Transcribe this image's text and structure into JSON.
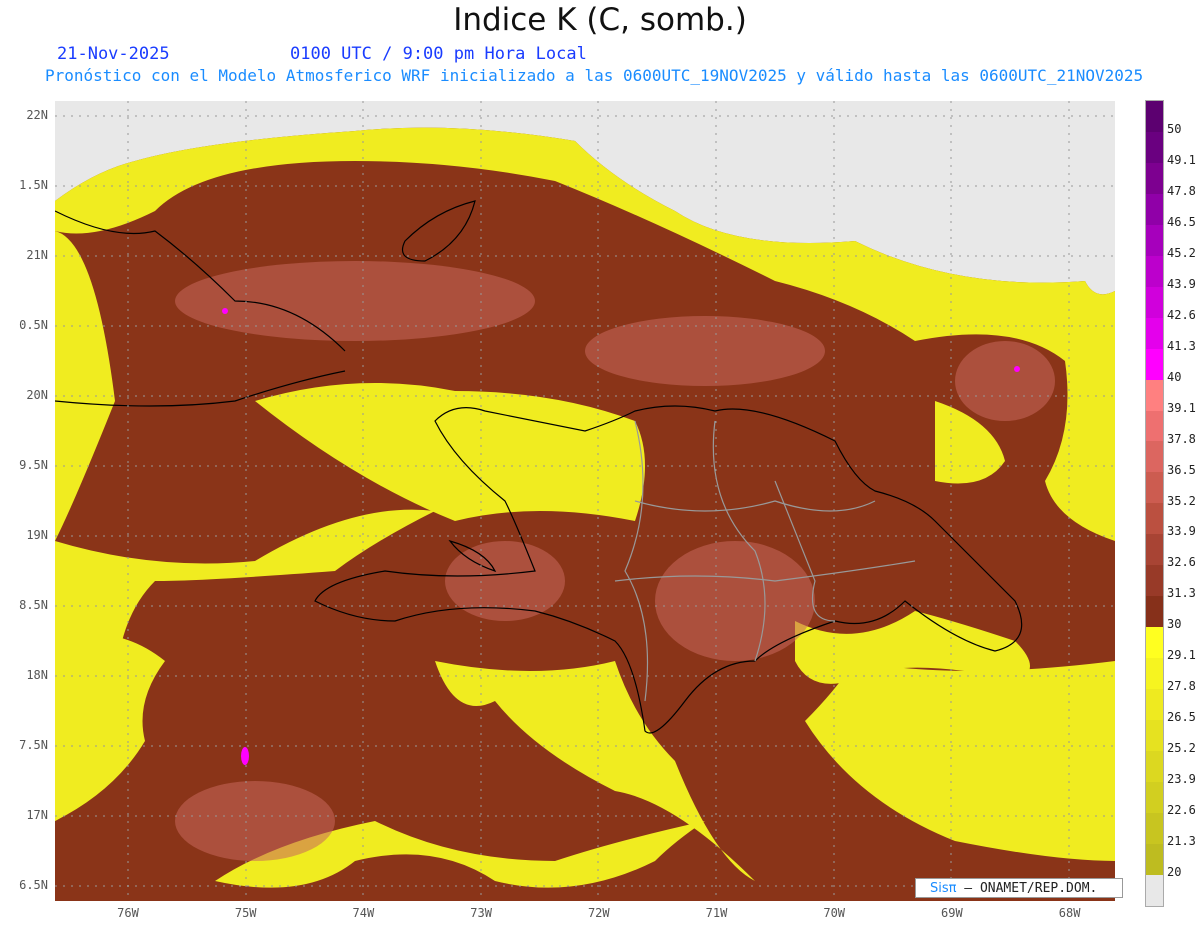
{
  "header": {
    "title": "Indice K (C, somb.)",
    "date": "21-Nov-2025",
    "time": "0100 UTC / 9:00 pm Hora Local",
    "subtitle": "Pronóstico con el Modelo Atmosferico WRF inicializado a las 0600UTC_19NOV2025 y válido hasta las  0600UTC_21NOV2025"
  },
  "map": {
    "lat_labels": [
      "22N",
      "1.5N",
      "21N",
      "0.5N",
      "20N",
      "9.5N",
      "19N",
      "8.5N",
      "18N",
      "7.5N",
      "17N",
      "6.5N"
    ],
    "lon_labels": [
      "76W",
      "75W",
      "74W",
      "73W",
      "72W",
      "71W",
      "70W",
      "69W",
      "68W"
    ],
    "colors": {
      "missing": "#e8e8e8",
      "yellow": "#f0ec20",
      "brown": "#8a3418",
      "brown_light": "#b85545"
    }
  },
  "colorbar": {
    "labels": [
      "50",
      "49.1",
      "47.8",
      "46.5",
      "45.2",
      "43.9",
      "42.6",
      "41.3",
      "40",
      "39.1",
      "37.8",
      "36.5",
      "35.2",
      "33.9",
      "32.6",
      "31.3",
      "30",
      "29.1",
      "27.8",
      "26.5",
      "25.2",
      "23.9",
      "22.6",
      "21.3",
      "20"
    ],
    "colors": [
      "#5c0070",
      "#6a0080",
      "#7d0090",
      "#9000a8",
      "#a600bc",
      "#bc00cc",
      "#d000dc",
      "#e400ec",
      "#ff00ff",
      "#ff8080",
      "#ee7070",
      "#dc6660",
      "#cc5c50",
      "#bb5040",
      "#a84434",
      "#983a28",
      "#86301a",
      "#ffff20",
      "#f6f420",
      "#eeea20",
      "#e6e220",
      "#dcd820",
      "#d2cf20",
      "#c8c520",
      "#bebc20",
      "#e8e8e8"
    ]
  },
  "footer": {
    "logo": "Sisπ",
    "credit": "– ONAMET/REP.DOM."
  }
}
